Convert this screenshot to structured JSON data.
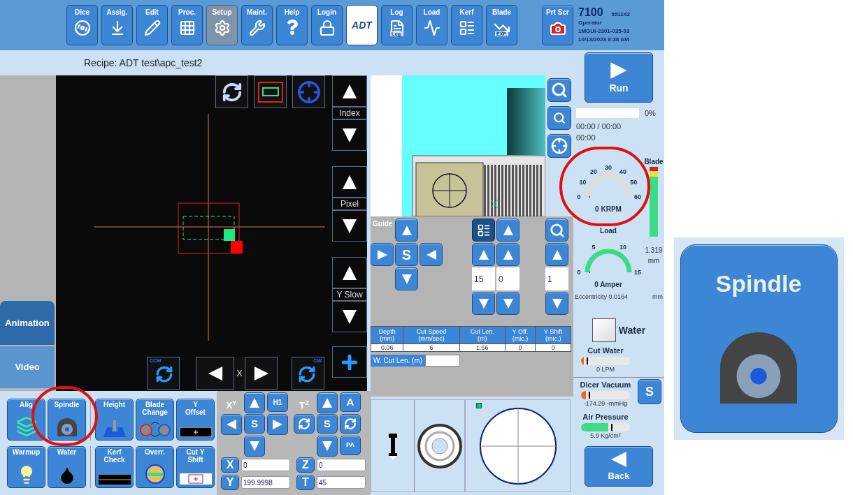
{
  "toolbar": [
    {
      "kind": "button",
      "label": "Dice",
      "disabled": false
    },
    {
      "kind": "button",
      "label": "Assig.",
      "disabled": false
    },
    {
      "kind": "button",
      "label": "Edit",
      "disabled": false
    },
    {
      "kind": "button",
      "label": "Proc.",
      "disabled": false
    },
    {
      "kind": "button",
      "label": "Setup",
      "disabled": true
    },
    {
      "kind": "button",
      "label": "Maint.",
      "disabled": false
    },
    {
      "kind": "button",
      "label": "Help",
      "disabled": false
    },
    {
      "kind": "button",
      "label": "Login",
      "disabled": false
    },
    {
      "kind": "logo",
      "label": "ADT"
    },
    {
      "kind": "button",
      "label": "Log",
      "icon_text": "Log.",
      "disabled": false
    },
    {
      "kind": "button",
      "label": "Load",
      "disabled": false
    },
    {
      "kind": "button",
      "label": "Kerf",
      "disabled": false
    },
    {
      "kind": "button",
      "label": "Blade",
      "icon_text": "EXP.",
      "disabled": false
    }
  ],
  "print_button": "Prt Scr",
  "status": {
    "model": "7100",
    "serial": "551142",
    "role": "Operator",
    "version": "1MGUI-2301-025-03",
    "datetime": "10/13/2023 8:38 AM"
  },
  "recipe": "Recipe: ADT test\\apc_test2",
  "view_tabs": [
    {
      "label": "Animation",
      "selected": true
    },
    {
      "label": "Video",
      "selected": false
    }
  ],
  "camera": {
    "steps": [
      "Index",
      "Pixel",
      "Y Slow"
    ],
    "rotate_ccw": "CCW",
    "rotate_cw": "CW",
    "axis": "X"
  },
  "guide": {
    "title": "Guide",
    "center": "S",
    "depth_values": [
      "15",
      "0"
    ],
    "zoom_value": "1"
  },
  "cut_table": {
    "columns": [
      "Depth\n(mm)",
      "Cut Speed\n(mm/sec)",
      "Cut Len.\n(m)",
      "Y Off.\n(mic.)",
      "Y Shift\n(mic.)"
    ],
    "rows": [
      [
        "0.06",
        "6",
        "1.56",
        "0",
        "0"
      ]
    ]
  },
  "w_cut_label": "W. Cut Len. (m)",
  "run": "Run",
  "progress": {
    "level": 0,
    "percent": "0%",
    "elapsed": "00:00 / 00:00",
    "remaining": "00:00"
  },
  "spindle_gauge": {
    "ticks": [
      "0",
      "10",
      "20",
      "30",
      "40",
      "50",
      "60"
    ],
    "level": 0,
    "reading": "0 KRPM"
  },
  "load_gauge": {
    "title": "Load",
    "ticks": [
      "0",
      "5",
      "10",
      "15"
    ],
    "level": 0,
    "reading": "0 Amper"
  },
  "blade": {
    "title": "Blade",
    "value": "1.319",
    "unit": "mm"
  },
  "eccentricity": {
    "label": "Eccentricity 0.0164",
    "unit": "mm"
  },
  "water": {
    "label": "Water",
    "checked": false
  },
  "meters": [
    {
      "title": "Cut Water",
      "level": 0.05,
      "reading": "0 LPM",
      "color": "#f26522"
    },
    {
      "title": "Dicer Vacuum",
      "level": 0.1,
      "reading": "-174.29 -mmHg",
      "color": "#f26522"
    },
    {
      "title": "Air Pressure",
      "level": 0.55,
      "reading": "5.9 Kg/cm²",
      "color": "#3ddc84"
    }
  ],
  "vacuum_button": "S",
  "back": "Back",
  "functions": [
    {
      "label": "Alig"
    },
    {
      "label": "Spindle"
    },
    {
      "label": "Height"
    },
    {
      "label": "Blade\nChange"
    },
    {
      "label": "Y\nOffset"
    },
    {
      "label": "Warmup"
    },
    {
      "label": "Water"
    },
    {
      "label": "Kerf\nCheck"
    },
    {
      "label": "Overr."
    },
    {
      "label": "Cut Y\nShift"
    }
  ],
  "jog": {
    "xy_label": "X$^{Y}$",
    "tz_label": "T$^{Z}$",
    "home": "H1",
    "xy_stop": "S",
    "tz_stop": "S",
    "align": "A",
    "pa": "PA",
    "fields": [
      {
        "axis": "X",
        "value": "0"
      },
      {
        "axis": "Z",
        "value": "0"
      },
      {
        "axis": "Y",
        "value": "199.9998"
      },
      {
        "axis": "T",
        "value": "45"
      }
    ]
  },
  "inset": {
    "label": "Spindle"
  }
}
